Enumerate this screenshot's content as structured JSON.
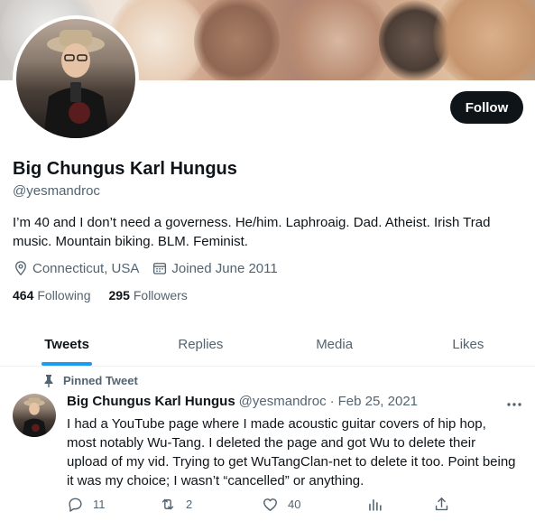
{
  "profile": {
    "display_name": "Big Chungus Karl Hungus",
    "handle": "@yesmandroc",
    "bio": "I’m 40 and I don’t need a governess. He/him. Laphroaig. Dad. Atheist. Irish Trad music. Mountain biking. BLM. Feminist.",
    "location": "Connecticut, USA",
    "joined": "Joined June 2011",
    "following_count": "464",
    "following_label": "Following",
    "followers_count": "295",
    "followers_label": "Followers",
    "follow_label": "Follow"
  },
  "tabs": [
    {
      "label": "Tweets",
      "active": true
    },
    {
      "label": "Replies",
      "active": false
    },
    {
      "label": "Media",
      "active": false
    },
    {
      "label": "Likes",
      "active": false
    }
  ],
  "pinned_tweet": {
    "pinned_label": "Pinned Tweet",
    "author_name": "Big Chungus Karl Hungus",
    "author_handle": "@yesmandroc",
    "separator": "·",
    "date": "Feb 25, 2021",
    "text": "I had a YouTube page where I made acoustic guitar covers of hip hop, most notably Wu-Tang. I deleted the page and got Wu to delete their upload of my vid. Trying to get WuTangClan-net to delete it too. Point being it was my choice; I wasn’t “cancelled” or anything.",
    "reply_count": "11",
    "retweet_count": "2",
    "like_count": "40"
  },
  "icons": {
    "location": "location-pin-icon",
    "joined": "calendar-icon",
    "pin": "pin-icon",
    "more": "more-horizontal-icon",
    "reply": "reply-bubble-icon",
    "retweet": "retweet-icon",
    "like": "heart-icon",
    "analytics": "analytics-bars-icon",
    "share": "share-icon"
  },
  "colors": {
    "text_primary": "#0f1419",
    "text_secondary": "#536471",
    "accent": "#1d9bf0",
    "follow_button_bg": "#0f1419"
  }
}
